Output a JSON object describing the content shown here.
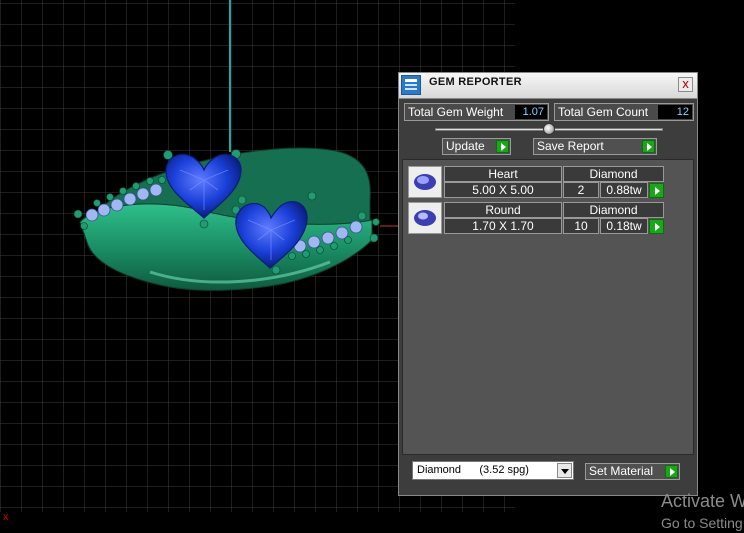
{
  "panel": {
    "title": "GEM REPORTER",
    "close_glyph": "x",
    "total_weight_label": "Total Gem Weight",
    "total_weight_value": "1.07",
    "total_count_label": "Total Gem Count",
    "total_count_value": "12",
    "update_label": "Update",
    "save_report_label": "Save Report",
    "gems": [
      {
        "shape": "Heart",
        "material": "Diamond",
        "size": "5.00 X 5.00",
        "count": "2",
        "weight": "0.88tw"
      },
      {
        "shape": "Round",
        "material": "Diamond",
        "size": "1.70 X 1.70",
        "count": "10",
        "weight": "0.18tw"
      }
    ],
    "material_select_value": "Diamond      (3.52 spg)",
    "set_material_label": "Set Material"
  },
  "viewport": {
    "marker": "x",
    "colors": {
      "background": "#000000",
      "grid": "#3c3c3c",
      "axis": "#1fa6a6",
      "metal": "#1f9c73",
      "gem": "#1a3fd8",
      "small_gem": "#9fb8f2"
    }
  },
  "watermark": {
    "line1": "Activate W",
    "line2": "Go to Setting"
  },
  "icons": [
    "gem-reporter-icon",
    "close-icon",
    "play-arrow-icon",
    "dropdown-arrow-icon",
    "heart-gem-icon",
    "round-gem-icon"
  ]
}
